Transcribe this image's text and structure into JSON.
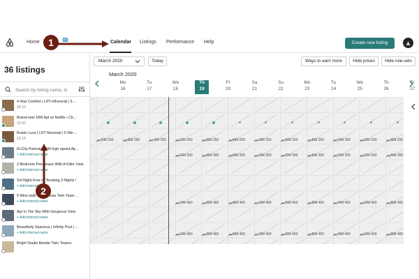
{
  "nav": {
    "items": [
      {
        "label": "Home"
      },
      {
        "label": "Calendar"
      },
      {
        "label": "Listings"
      },
      {
        "label": "Performance"
      },
      {
        "label": "Help"
      }
    ],
    "badge": "NEW",
    "cta_label": "Create new listing"
  },
  "left": {
    "count_label": "36 listings",
    "search_placeholder": "Search by listing name, lo",
    "listings": [
      {
        "title": "4-Star Comfort | LRT+Monorail | 6 ...",
        "sub": "23-10",
        "sub_link": false,
        "active": false,
        "thumb": "#8b6b4e"
      },
      {
        "title": "Brand-new 1BR Apt w/ Netflix • Cit...",
        "sub": "12-02",
        "sub_link": false,
        "active": true,
        "thumb": "#c7a27a"
      },
      {
        "title": "Rustic Luxe | LRT Monorail | 6 Min ...",
        "sub": "23-13",
        "sub_link": false,
        "active": true,
        "thumb": "#7a5a3e"
      },
      {
        "title": "KLCity Parkview Wifi high speed,Ap...",
        "sub": "+ Add internal name",
        "sub_link": true,
        "active": false,
        "thumb": "#6a7d8a"
      },
      {
        "title": "2-Bedroom Penthouse With A Killer View",
        "sub": "+ Add internal name",
        "sub_link": true,
        "active": false,
        "thumb": "#b3b1a8"
      },
      {
        "title": "3rd Night Free by Booking 3 Nights !",
        "sub": "+ Add internal name",
        "sub_link": true,
        "active": false,
        "thumb": "#4e6e86"
      },
      {
        "title": "5 Mins walk to Petronas Twin Towe...",
        "sub": "+ Add internal name",
        "sub_link": true,
        "active": false,
        "thumb": "#3d4b5c"
      },
      {
        "title": "Apt In The Sky With Gorgeous View",
        "sub": "+ Add internal name",
        "sub_link": true,
        "active": false,
        "thumb": "#5c6a78"
      },
      {
        "title": "Beautifully Spacious | Infinity Pool | ...",
        "sub": "+ Add internal name",
        "sub_link": true,
        "active": false,
        "thumb": "#8fa7b8"
      },
      {
        "title": "Bright Studio Beside Twin Towers",
        "sub": "",
        "sub_link": false,
        "active": false,
        "thumb": "#c9b99a"
      }
    ]
  },
  "toolbar": {
    "month_select": "March 2020",
    "today_label": "Today",
    "earn_label": "Ways to earn more",
    "hide_prices_label": "Hide prices",
    "hide_rules_label": "Hide rule-sets"
  },
  "calendar": {
    "month_label": "March 2020",
    "days": [
      {
        "name": "Mo",
        "date": "16"
      },
      {
        "name": "Tu",
        "date": "17"
      },
      {
        "name": "We",
        "date": "18"
      },
      {
        "name": "Th",
        "date": "19",
        "today": true
      },
      {
        "name": "Fr",
        "date": "20"
      },
      {
        "name": "Sa",
        "date": "21"
      },
      {
        "name": "Su",
        "date": "22"
      },
      {
        "name": "Mo",
        "date": "23"
      },
      {
        "name": "Tu",
        "date": "24"
      },
      {
        "name": "We",
        "date": "25"
      },
      {
        "name": "Th",
        "date": "26"
      },
      {
        "name": "Fr",
        "date": "27"
      }
    ],
    "row_prices": [
      "",
      "",
      "RM 250",
      "RM 300",
      "",
      "",
      "RM 460",
      "",
      "RM 460"
    ]
  },
  "annotations": [
    {
      "label": "1"
    },
    {
      "label": "2"
    }
  ],
  "colors": {
    "accent": "#2a7a78",
    "annotation": "#6b1e12",
    "grid_bg": "#efefef"
  }
}
